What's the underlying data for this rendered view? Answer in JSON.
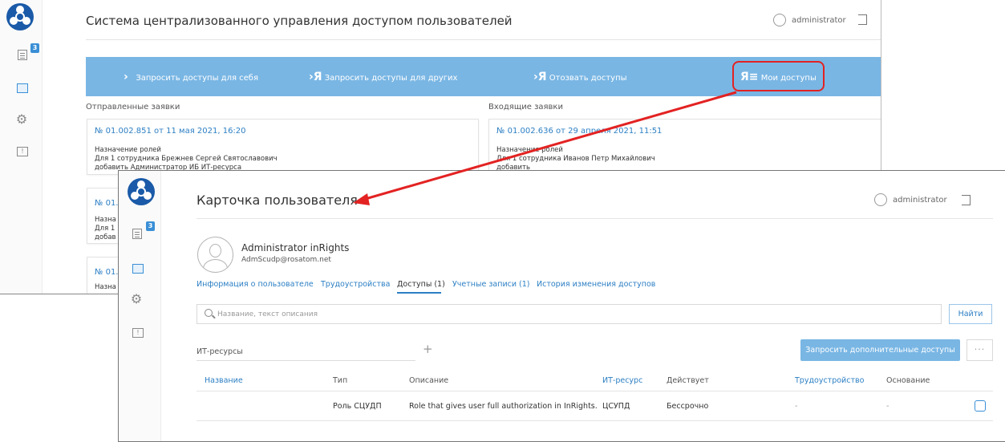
{
  "back_window": {
    "title": "Система централизованного управления доступом пользователей",
    "username": "administrator",
    "badge_count": "3",
    "menu": [
      {
        "glyph": "›",
        "label": "Запросить доступы для себя"
      },
      {
        "glyph": "›Я",
        "label": "Запросить доступы для других"
      },
      {
        "glyph": "›Я",
        "label": "Отозвать доступы"
      },
      {
        "glyph": "Я≡",
        "label": "Мои доступы"
      }
    ],
    "sent_label": "Отправленные заявки",
    "incoming_label": "Входящие заявки",
    "sent_cards": [
      {
        "number": "№ 01.002.851 от 11 мая 2021, 16:20",
        "line1": "Назначение ролей",
        "line2": "Для 1 сотрудника Брежнев Сергей Святославович",
        "line3": "добавить Администратор ИБ ИТ-ресурса"
      },
      {
        "number": "№ 01.",
        "line1": "Назна",
        "line2": "Для 1",
        "line3": "добав"
      },
      {
        "number": "№ 01.",
        "line1": "Назна"
      }
    ],
    "incoming_cards": [
      {
        "number": "№ 01.002.636 от 29 апреля 2021, 11:51",
        "line1": "Назначение ролей",
        "line2": "Для 1 сотрудника Иванов Петр Михайлович",
        "line3": "добавить"
      }
    ]
  },
  "front_window": {
    "title": "Карточка пользователя",
    "username": "administrator",
    "badge_count": "3",
    "user": {
      "name": "Administrator inRights",
      "email": "AdmScudp@rosatom.net"
    },
    "tabs": [
      "Информация о пользователе",
      "Трудоустройства",
      "Доступы (1)",
      "Учетные записи (1)",
      "История изменения доступов"
    ],
    "active_tab": "Доступы (1)",
    "search_placeholder": "Название, текст описания",
    "find_button": "Найти",
    "it_resources_label": "ИТ-ресурсы",
    "plus": "+",
    "request_button": "Запросить дополнительные доступы",
    "more_button": "···",
    "table": {
      "headers": [
        "Название",
        "Тип",
        "Описание",
        "ИТ-ресурс",
        "Действует",
        "Трудоустройство",
        "Основание"
      ],
      "rows": [
        [
          "",
          "Роль СЦУДП",
          "Role that gives user full authorization in InRights.",
          "ЦСУПД",
          "Бессрочно",
          "-",
          "-"
        ]
      ]
    }
  },
  "colors": {
    "accent": "#79b6e4",
    "link": "#2c7fc4",
    "highlight": "#e32222",
    "logo": "#1a5aa8"
  },
  "icons": [
    "logo-icon",
    "requests-icon",
    "monitor-icon",
    "gear-icon",
    "feedback-icon",
    "user-icon",
    "logout-icon",
    "search-icon",
    "checkbox"
  ]
}
